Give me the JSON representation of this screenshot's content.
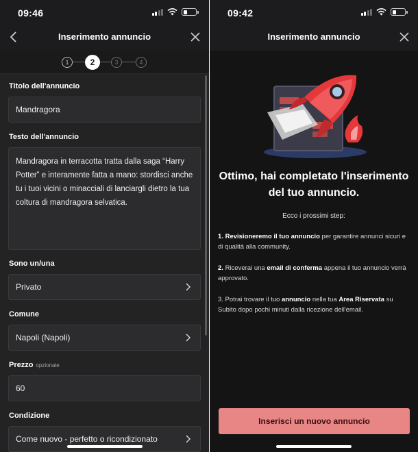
{
  "left": {
    "status_time": "09:46",
    "nav_title": "Inserimento annuncio",
    "steps": [
      "1",
      "2",
      "3",
      "4"
    ],
    "active_step": 2,
    "fields": {
      "titolo_label": "Titolo dell'annuncio",
      "titolo_value": "Mandragora",
      "testo_label": "Testo dell'annuncio",
      "testo_value": "Mandragora in terracotta tratta dalla saga “Harry Potter” e interamente fatta a mano: stordisci anche tu i tuoi vicini o minacciali di lanciargli dietro la tua coltura di mandragora selvatica.",
      "sono_label": "Sono un/una",
      "sono_value": "Privato",
      "comune_label": "Comune",
      "comune_value": "Napoli (Napoli)",
      "prezzo_label": "Prezzo",
      "prezzo_optional": "opzionale",
      "prezzo_value": "60",
      "condizione_label": "Condizione",
      "condizione_value": "Come nuovo - perfetto o ricondizionato"
    }
  },
  "right": {
    "status_time": "09:42",
    "nav_title": "Inserimento annuncio",
    "heading": "Ottimo, hai completato l'inserimento del tuo annuncio.",
    "steps_intro": "Ecco i prossimi step:",
    "step1": {
      "num": "1.",
      "bold": "Revisioneremo il tuo annuncio",
      "rest": "per garantire annunci sicuri e di qualità alla community."
    },
    "step2": {
      "num": "2.",
      "pre": "Riceverai una",
      "bold": "email di conferma",
      "rest": "appena il tuo annuncio verrà approvato."
    },
    "step3": {
      "pre": "3. Potrai trovare il tuo",
      "bold1": "annuncio",
      "mid": "nella tua",
      "bold2": "Area Riservata",
      "rest": "su Subito dopo pochi minuti dalla ricezione dell'email."
    },
    "cta_label": "Inserisci un nuovo annuncio"
  },
  "colors": {
    "background": "#1c1c1e",
    "accent": "#e88585",
    "rocket": "#e5383b"
  }
}
